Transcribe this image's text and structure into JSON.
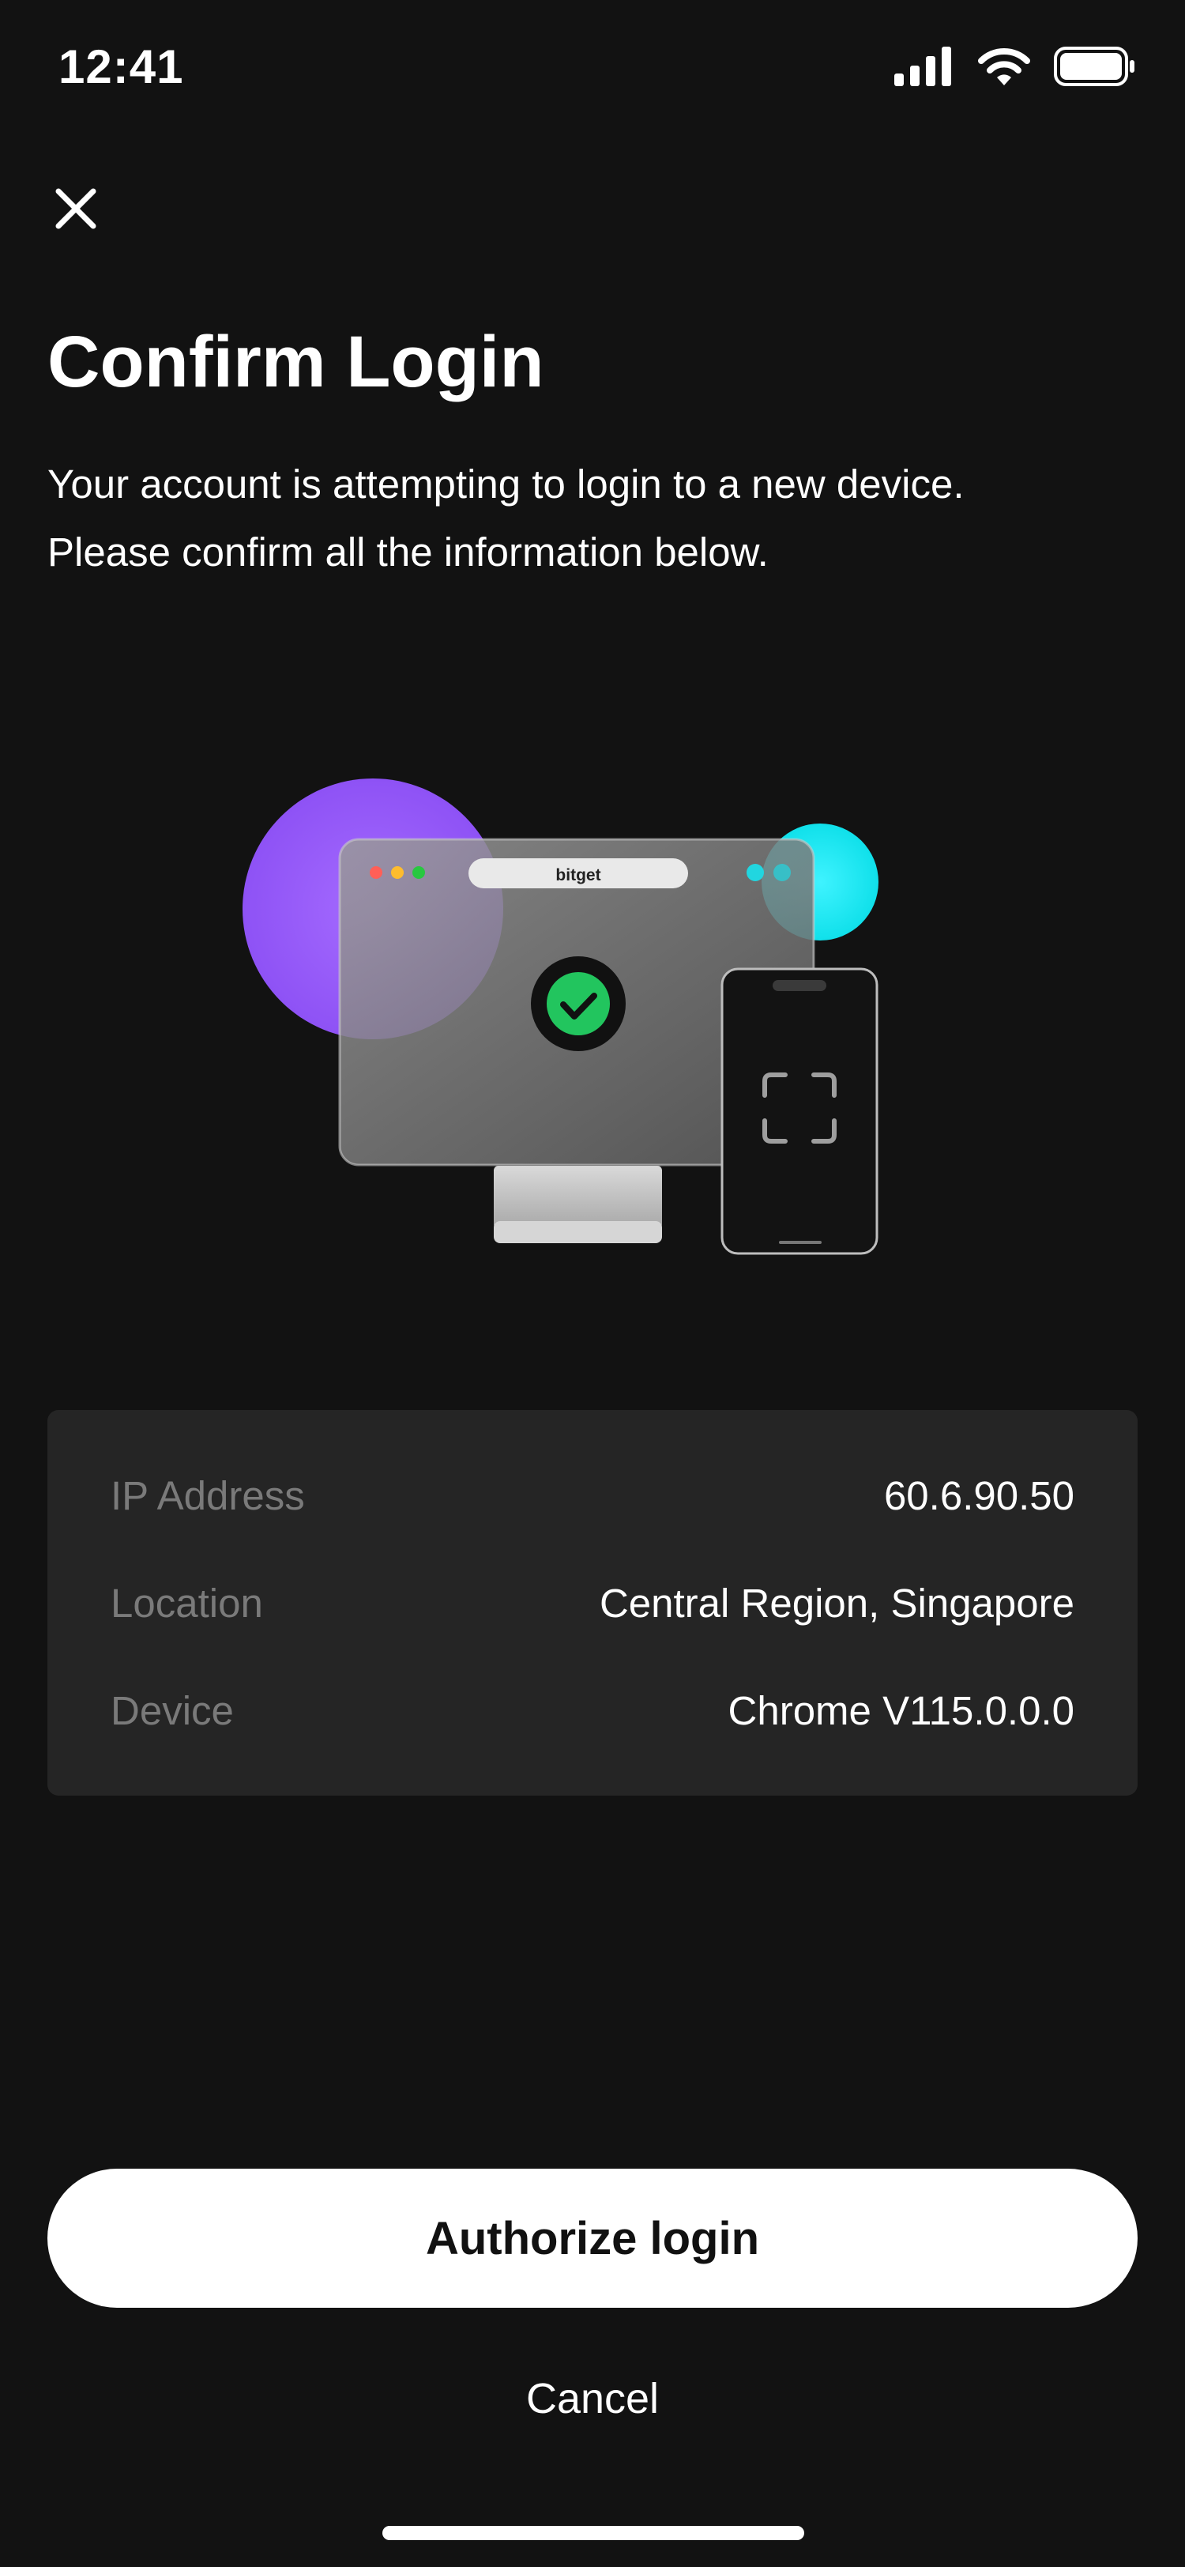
{
  "status_bar": {
    "time": "12:41",
    "icons": [
      "cellular-signal-icon",
      "wifi-icon",
      "battery-icon"
    ]
  },
  "header": {
    "close_icon": "close-icon",
    "title": "Confirm Login",
    "subtitle_line1": "Your account is attempting to login to a new device.",
    "subtitle_line2": "Please confirm all the information below."
  },
  "illustration": {
    "browser_label": "bitget",
    "check_icon": "checkmark-icon",
    "scan_icon": "scan-frame-icon",
    "colors": {
      "purple": "#9B5CFF",
      "cyan": "#19E6F0",
      "check_green": "#22C55E"
    }
  },
  "info": {
    "rows": [
      {
        "label": "IP Address",
        "value": "60.6.90.50"
      },
      {
        "label": "Location",
        "value": "Central Region, Singapore"
      },
      {
        "label": "Device",
        "value": "Chrome V115.0.0.0"
      }
    ]
  },
  "actions": {
    "authorize_label": "Authorize login",
    "cancel_label": "Cancel"
  }
}
